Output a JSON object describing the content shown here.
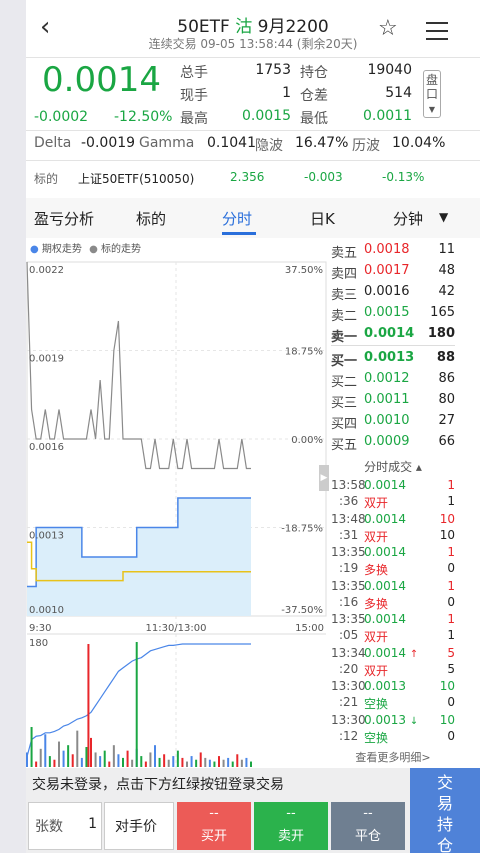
{
  "header": {
    "title_prefix": "50ETF",
    "title_mark": "沽",
    "title_suffix": "9月2200",
    "subtitle": "连续交易 09-05 13:58:44 (剩余20天)"
  },
  "quote": {
    "price": "0.0014",
    "change": "-0.0002",
    "change_pct": "-12.50%",
    "stats": [
      {
        "label": "总手",
        "value": "1753"
      },
      {
        "label": "持仓",
        "value": "19040"
      },
      {
        "label": "现手",
        "value": "1"
      },
      {
        "label": "仓差",
        "value": "514"
      },
      {
        "label": "最高",
        "value": "0.0015"
      },
      {
        "label": "最低",
        "value": "0.0011"
      }
    ],
    "pankou_label": "盘口",
    "pankou_arrow": "▼"
  },
  "greeks": {
    "delta_label": "Delta",
    "delta": "-0.0019",
    "gamma_label": "Gamma",
    "gamma": "0.1041",
    "iv_label": "隐波",
    "iv": "16.47%",
    "hv_label": "历波",
    "hv": "10.04%"
  },
  "underlying": {
    "label": "标的",
    "name": "上证50ETF(510050)",
    "price": "2.356",
    "change": "-0.003",
    "change_pct": "-0.13%"
  },
  "tabs": [
    "盈亏分析",
    "标的",
    "分时",
    "日K",
    "分钟"
  ],
  "tab_more_icon": "caret-down-icon",
  "chart_data": {
    "type": "line",
    "legend": [
      "期权走势",
      "标的走势"
    ],
    "y_left_ticks": [
      "0.0022",
      "0.0019",
      "0.0016",
      "0.0013",
      "0.0010"
    ],
    "y_right_ticks": [
      "37.50%",
      "18.75%",
      "0.00%",
      "-18.75%",
      "-37.50%"
    ],
    "x_ticks": [
      "9:30",
      "11:30/13:00",
      "15:00"
    ],
    "volume_max_label": "180",
    "ylim": [
      0.001,
      0.0022
    ],
    "series": [
      {
        "name": "期权走势",
        "color": "#4a86e8",
        "values": [
          0.0011,
          0.0011,
          0.0013,
          0.0013,
          0.0013,
          0.0013,
          0.0013,
          0.0013,
          0.0013,
          0.0013,
          0.0013,
          0.0013,
          0.0012,
          0.0012,
          0.0012,
          0.0012,
          0.0012,
          0.0012,
          0.0012,
          0.0012,
          0.0012,
          0.0012,
          0.0012,
          0.0012,
          0.0013,
          0.0013,
          0.0013,
          0.0013,
          0.0013,
          0.0013,
          0.0013,
          0.0013,
          0.0013,
          0.0014,
          0.0014,
          0.0014,
          0.0014,
          0.0014,
          0.0014,
          0.0014,
          0.0014,
          0.0014,
          0.0014,
          0.0014,
          0.0014,
          0.0014,
          0.0014,
          0.0014,
          0.0014,
          0.0014
        ]
      },
      {
        "name": "标的走势",
        "color": "#8a8a8a",
        "values": [
          0.0022,
          0.0017,
          0.0016,
          0.0016,
          0.0017,
          0.0016,
          0.0016,
          0.0017,
          0.0016,
          0.0016,
          0.0016,
          0.0016,
          0.0016,
          0.0016,
          0.0017,
          0.0016,
          0.0018,
          0.0016,
          0.0016,
          0.0019,
          0.002,
          0.0016,
          0.0016,
          0.0016,
          0.0016,
          0.0016,
          0.0015,
          0.0015,
          0.0016,
          0.0015,
          0.0015,
          0.0015,
          0.0016,
          0.0015,
          0.0015,
          0.0016,
          0.0015,
          0.0015,
          0.0015,
          0.0015,
          0.0015,
          0.0015,
          0.0016,
          0.0015,
          0.0015,
          0.0015,
          0.0015,
          0.0016,
          0.0015,
          0.0015
        ]
      },
      {
        "name": "均价",
        "color": "#e8c21a",
        "values": [
          0.00125,
          0.00116,
          0.00112,
          0.00112,
          0.00112,
          0.00112,
          0.00112,
          0.00112,
          0.00112,
          0.00112,
          0.00112,
          0.00112,
          0.00112,
          0.00112,
          0.00112,
          0.00112,
          0.00112,
          0.00112,
          0.00112,
          0.00112,
          0.00112,
          0.00115,
          0.00115,
          0.00115,
          0.00115,
          0.00115,
          0.00115,
          0.00115,
          0.00115,
          0.00115,
          0.00115,
          0.00115,
          0.00115,
          0.00115,
          0.00115,
          0.00115,
          0.00115,
          0.00115,
          0.00115,
          0.00115,
          0.00115,
          0.00115,
          0.00115,
          0.00115,
          0.00115,
          0.00115,
          0.00115,
          0.00115,
          0.00115,
          0.00115
        ]
      }
    ],
    "cum_volume": [
      15,
      40,
      45,
      46,
      50,
      50,
      52,
      55,
      60,
      62,
      66,
      70,
      72,
      75,
      80,
      90,
      100,
      110,
      120,
      130,
      140,
      145,
      150,
      155,
      158,
      160,
      165,
      170,
      172,
      174,
      176,
      178,
      178,
      179,
      180,
      180,
      180,
      180,
      180,
      180,
      180,
      180,
      180,
      180,
      180,
      180,
      180,
      180,
      180,
      180
    ],
    "volume_bars": [
      8,
      22,
      3,
      10,
      18,
      6,
      4,
      14,
      9,
      12,
      7,
      20,
      5,
      11,
      16,
      8,
      6,
      9,
      3,
      12,
      7,
      5,
      9,
      4,
      10,
      6,
      3,
      8,
      12,
      5,
      7,
      4,
      6,
      9,
      5,
      3,
      6,
      4,
      8,
      5,
      4,
      3,
      6,
      4,
      5,
      3,
      7,
      4,
      5,
      3
    ]
  },
  "order_book": {
    "asks": [
      {
        "label": "卖五",
        "price": "0.0018",
        "vol": "11",
        "color": "red"
      },
      {
        "label": "卖四",
        "price": "0.0017",
        "vol": "48",
        "color": "red"
      },
      {
        "label": "卖三",
        "price": "0.0016",
        "vol": "42",
        "color": "black"
      },
      {
        "label": "卖二",
        "price": "0.0015",
        "vol": "165",
        "color": "green"
      },
      {
        "label": "卖一",
        "price": "0.0014",
        "vol": "180",
        "color": "green"
      }
    ],
    "bids": [
      {
        "label": "买一",
        "price": "0.0013",
        "vol": "88",
        "color": "green"
      },
      {
        "label": "买二",
        "price": "0.0012",
        "vol": "86",
        "color": "green"
      },
      {
        "label": "买三",
        "price": "0.0011",
        "vol": "80",
        "color": "green"
      },
      {
        "label": "买四",
        "price": "0.0010",
        "vol": "27",
        "color": "green"
      },
      {
        "label": "买五",
        "price": "0.0009",
        "vol": "66",
        "color": "green"
      }
    ]
  },
  "trades_header": "分时成交 ▴",
  "trades": [
    {
      "time1": "13:58",
      "price": "0.0014",
      "qty": "1",
      "time2": ":36",
      "type": "双开",
      "oi": "1",
      "pcolor": "green",
      "qcolor": "red",
      "tcolor": "red",
      "arrow": ""
    },
    {
      "time1": "13:48",
      "price": "0.0014",
      "qty": "10",
      "time2": ":31",
      "type": "双开",
      "oi": "10",
      "pcolor": "green",
      "qcolor": "red",
      "tcolor": "red",
      "arrow": ""
    },
    {
      "time1": "13:35",
      "price": "0.0014",
      "qty": "1",
      "time2": ":19",
      "type": "多换",
      "oi": "0",
      "pcolor": "green",
      "qcolor": "red",
      "tcolor": "red",
      "arrow": ""
    },
    {
      "time1": "13:35",
      "price": "0.0014",
      "qty": "1",
      "time2": ":16",
      "type": "多换",
      "oi": "0",
      "pcolor": "green",
      "qcolor": "red",
      "tcolor": "red",
      "arrow": ""
    },
    {
      "time1": "13:35",
      "price": "0.0014",
      "qty": "1",
      "time2": ":05",
      "type": "双开",
      "oi": "1",
      "pcolor": "green",
      "qcolor": "red",
      "tcolor": "red",
      "arrow": ""
    },
    {
      "time1": "13:34",
      "price": "0.0014",
      "qty": "5",
      "time2": ":20",
      "type": "双开",
      "oi": "5",
      "pcolor": "green",
      "qcolor": "red",
      "tcolor": "red",
      "arrow": "↑"
    },
    {
      "time1": "13:30",
      "price": "0.0013",
      "qty": "10",
      "time2": ":21",
      "type": "空换",
      "oi": "0",
      "pcolor": "green",
      "qcolor": "green",
      "tcolor": "green",
      "arrow": ""
    },
    {
      "time1": "13:30",
      "price": "0.0013",
      "qty": "10",
      "time2": ":12",
      "type": "空换",
      "oi": "0",
      "pcolor": "green",
      "qcolor": "green",
      "tcolor": "green",
      "arrow": "↓"
    }
  ],
  "more_details": "查看更多明细>",
  "bottom": {
    "login_msg": "交易未登录，点击下方红绿按钮登录交易",
    "qty_label": "张数",
    "qty_value": "1",
    "price_mode": "对手价",
    "buy_open_top": "--",
    "buy_open": "买开",
    "sell_open_top": "--",
    "sell_open": "卖开",
    "close_top": "--",
    "close": "平仓",
    "trade_hold": "交易持仓"
  },
  "colors": {
    "red": "#e8262a",
    "green": "#1aa643",
    "blue": "#2a6fdb",
    "buy_btn": "#ec5b57",
    "sell_btn": "#2bb24c",
    "close_btn": "#6f7f91",
    "trade_btn": "#4f82d8"
  }
}
